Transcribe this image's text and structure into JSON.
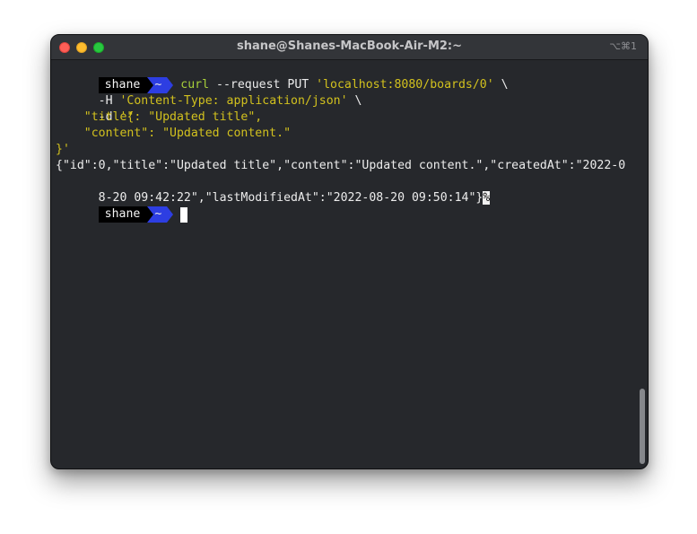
{
  "window": {
    "title": "shane@Shanes-MacBook-Air-M2:~",
    "shortcut": "⌥⌘1"
  },
  "prompt": {
    "user": "shane",
    "dir": "~"
  },
  "command": {
    "cmd": "curl",
    "args": " --request PUT ",
    "url": "'localhost:8080/boards/0'",
    "continuation": " \\"
  },
  "lines": {
    "header_flag": "-H ",
    "header_value": "'Content-Type: application/json'",
    "header_cont": " \\",
    "data_flag": "-d ",
    "data_open": "'{",
    "data_title": "    \"title\": \"Updated title\",",
    "data_content": "    \"content\": \"Updated content.\"",
    "data_close": "}'"
  },
  "output": {
    "line1": "{\"id\":0,\"title\":\"Updated title\",\"content\":\"Updated content.\",\"createdAt\":\"2022-0",
    "line2": "8-20 09:42:22\",\"lastModifiedAt\":\"2022-08-20 09:50:14\"}",
    "no_newline_marker": "%"
  },
  "colors": {
    "terminal_bg": "#26282c",
    "command_green": "#a7cf3a",
    "string_yellow": "#d2c11e",
    "prompt_blue": "#2d3ee2"
  }
}
